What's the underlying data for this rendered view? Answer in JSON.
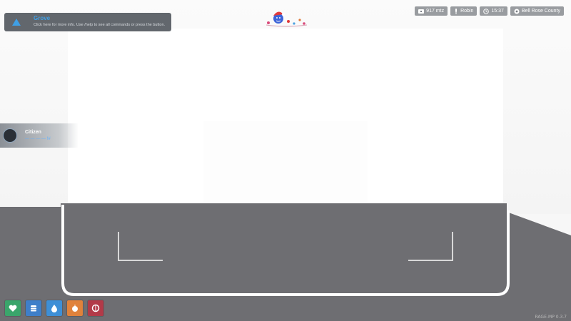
{
  "notification": {
    "title": "Grove",
    "text": "Click here for more info. Use /help to see all commands or press the button.",
    "icon": "arrow-up-icon",
    "accent": "#3fa0e6"
  },
  "status_bar": [
    {
      "label": "917 mtz",
      "icon": "money-icon"
    },
    {
      "label": "Robin",
      "icon": "microphone-icon"
    },
    {
      "label": "15:37",
      "icon": "clock-icon"
    },
    {
      "label": "Bell Rose County",
      "icon": "gear-icon"
    }
  ],
  "entity_card": {
    "name": "Citizen",
    "sub": "— — — —   !#",
    "icon": "avatar-icon"
  },
  "hotbar": [
    {
      "name": "health",
      "icon": "heart-icon",
      "color": "#3aa56b"
    },
    {
      "name": "food",
      "icon": "burger-icon",
      "color": "#3f7fc9"
    },
    {
      "name": "water",
      "icon": "droplet-icon",
      "color": "#3e8fd6"
    },
    {
      "name": "hunger",
      "icon": "fruit-icon",
      "color": "#e0823b"
    },
    {
      "name": "stress",
      "icon": "brain-icon",
      "color": "#b23a48"
    }
  ],
  "version": "RAGE-MP 0.3.7"
}
